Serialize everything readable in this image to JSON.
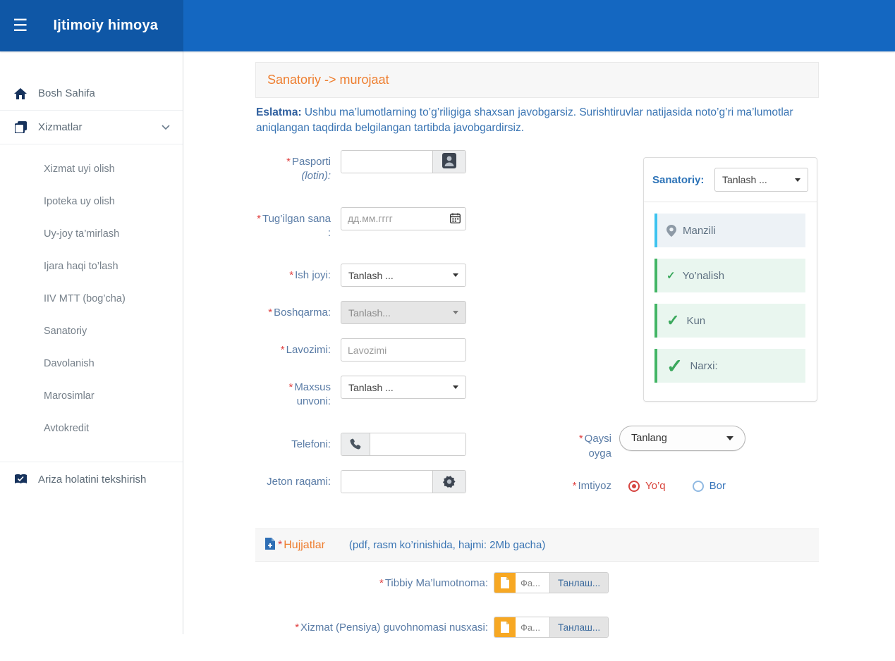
{
  "header": {
    "app_title": "Ijtimoiy himoya"
  },
  "sidebar": {
    "home": "Bosh Sahifa",
    "services": "Xizmatlar",
    "service_items": [
      "Xizmat uyi olish",
      "Ipoteka uy olish",
      "Uy-joy ta’mirlash",
      "Ijara haqi to’lash",
      "IIV MTT (bog’cha)",
      "Sanatoriy",
      "Davolanish",
      "Marosimlar",
      "Avtokredit"
    ],
    "check_status": "Ariza holatini tekshirish"
  },
  "page": {
    "title": "Sanatoriy -> murojaat",
    "note_label": "Eslatma:",
    "note_text": " Ushbu ma’lumotlarning to’g’riligiga shaxsan javobgarsiz. Surishtiruvlar natijasida noto’g’ri ma’lumotlar aniqlangan taqdirda belgilangan tartibda javobgardirsiz."
  },
  "form": {
    "required_mark": "*",
    "pasport": {
      "label": "Pasporti",
      "sublabel": "(lotin):"
    },
    "birthdate": {
      "label": "Tug’ilgan sana",
      "suffix": ":",
      "placeholder": "дд.мм.гггг"
    },
    "workplace": {
      "label": "Ish joyi:",
      "value": "Tanlash ..."
    },
    "department": {
      "label": "Boshqarma:",
      "value": "Tanlash..."
    },
    "position": {
      "label": "Lavozimi:",
      "placeholder": "Lavozimi"
    },
    "rank": {
      "label": "Maxsus unvoni:",
      "value": "Tanlash ..."
    },
    "phone": {
      "label": "Telefoni:"
    },
    "token": {
      "label": "Jeton raqami:"
    }
  },
  "sanatoriy_card": {
    "label": "Sanatoriy:",
    "select_value": "Tanlash ...",
    "items": [
      {
        "label": "Manzili"
      },
      {
        "label": "Yo’nalish"
      },
      {
        "label": "Kun"
      },
      {
        "label": "Narxi:"
      }
    ]
  },
  "month": {
    "label": "Qaysi oyga",
    "value": "Tanlang"
  },
  "imtiyoz": {
    "label": "Imtiyoz",
    "options": [
      {
        "label": "Yo’q",
        "selected": true
      },
      {
        "label": "Bor",
        "selected": false
      }
    ]
  },
  "documents": {
    "title": "Hujjatlar",
    "hint": "(pdf, rasm ko’rinishida, hajmi: 2Mb gacha)",
    "rows": [
      {
        "label": "Tibbiy Ma’lumotnoma:",
        "file_label": "Фа...",
        "browse": "Танлаш..."
      },
      {
        "label": "Xizmat (Pensiya) guvohnomasi nusxasi:",
        "file_label": "Фа...",
        "browse": "Танлаш..."
      }
    ]
  }
}
